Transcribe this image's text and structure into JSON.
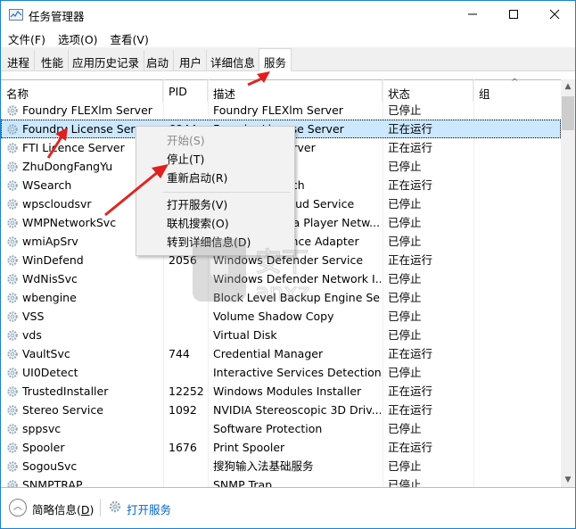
{
  "window": {
    "title": "任务管理器",
    "controls": {
      "minimize": "—",
      "maximize": "☐",
      "close": "✕"
    }
  },
  "menubar": {
    "items": [
      {
        "label": "文件(F)"
      },
      {
        "label": "选项(O)"
      },
      {
        "label": "查看(V)"
      }
    ]
  },
  "tabs": [
    {
      "label": "进程",
      "active": false
    },
    {
      "label": "性能",
      "active": false
    },
    {
      "label": "应用历史记录",
      "active": false
    },
    {
      "label": "启动",
      "active": false
    },
    {
      "label": "用户",
      "active": false
    },
    {
      "label": "详细信息",
      "active": false
    },
    {
      "label": "服务",
      "active": true
    }
  ],
  "table": {
    "columns": [
      {
        "key": "name",
        "label": "名称"
      },
      {
        "key": "pid",
        "label": "PID"
      },
      {
        "key": "desc",
        "label": "描述"
      },
      {
        "key": "status",
        "label": "状态"
      },
      {
        "key": "group",
        "label": "组"
      }
    ],
    "sort_indicator": "^",
    "rows": [
      {
        "name": "Foundry FLEXlm Server",
        "pid": "",
        "desc": "Foundry FLEXlm Server",
        "status": "已停止",
        "group": ""
      },
      {
        "name": "Foundry License Server",
        "pid": "6844",
        "desc": "Foundry License Server",
        "status": "正在运行",
        "group": "",
        "selected": true
      },
      {
        "name": "FTI Licence Server",
        "pid": "",
        "desc": "FTI Licence Server",
        "status": "正在运行",
        "group": ""
      },
      {
        "name": "ZhuDongFangYu",
        "pid": "",
        "desc": "",
        "status": "已停止",
        "group": ""
      },
      {
        "name": "WSearch",
        "pid": "",
        "desc": "Windows Search",
        "status": "正在运行",
        "group": ""
      },
      {
        "name": "wpscloudsvr",
        "pid": "",
        "desc": "WPS Office Cloud Service",
        "status": "已停止",
        "group": ""
      },
      {
        "name": "WMPNetworkSvc",
        "pid": "",
        "desc": "Windows Media Player Netw...",
        "status": "已停止",
        "group": ""
      },
      {
        "name": "wmiApSrv",
        "pid": "",
        "desc": "WMI Performance Adapter",
        "status": "已停止",
        "group": ""
      },
      {
        "name": "WinDefend",
        "pid": "2056",
        "desc": "Windows Defender Service",
        "status": "正在运行",
        "group": ""
      },
      {
        "name": "WdNisSvc",
        "pid": "",
        "desc": "Windows Defender Network I...",
        "status": "已停止",
        "group": ""
      },
      {
        "name": "wbengine",
        "pid": "",
        "desc": "Block Level Backup Engine Se...",
        "status": "已停止",
        "group": ""
      },
      {
        "name": "VSS",
        "pid": "",
        "desc": "Volume Shadow Copy",
        "status": "已停止",
        "group": ""
      },
      {
        "name": "vds",
        "pid": "",
        "desc": "Virtual Disk",
        "status": "已停止",
        "group": ""
      },
      {
        "name": "VaultSvc",
        "pid": "744",
        "desc": "Credential Manager",
        "status": "正在运行",
        "group": ""
      },
      {
        "name": "UI0Detect",
        "pid": "",
        "desc": "Interactive Services Detection",
        "status": "已停止",
        "group": ""
      },
      {
        "name": "TrustedInstaller",
        "pid": "12252",
        "desc": "Windows Modules Installer",
        "status": "正在运行",
        "group": ""
      },
      {
        "name": "Stereo Service",
        "pid": "1092",
        "desc": "NVIDIA Stereoscopic 3D Driv...",
        "status": "正在运行",
        "group": ""
      },
      {
        "name": "sppsvc",
        "pid": "",
        "desc": "Software Protection",
        "status": "已停止",
        "group": ""
      },
      {
        "name": "Spooler",
        "pid": "1676",
        "desc": "Print Spooler",
        "status": "正在运行",
        "group": ""
      },
      {
        "name": "SogouSvc",
        "pid": "",
        "desc": "搜狗输入法基础服务",
        "status": "已停止",
        "group": ""
      },
      {
        "name": "SNMPTRAP",
        "pid": "",
        "desc": "SNMP Trap",
        "status": "已停止",
        "group": ""
      }
    ]
  },
  "context_menu": {
    "items": [
      {
        "label": "开始(S)",
        "disabled": true
      },
      {
        "label": "停止(T)",
        "disabled": false
      },
      {
        "label": "重新启动(R)",
        "disabled": false
      },
      {
        "separator": true
      },
      {
        "label": "打开服务(V)",
        "disabled": false
      },
      {
        "label": "联机搜索(O)",
        "disabled": false
      },
      {
        "label": "转到详细信息(D)",
        "disabled": false
      }
    ]
  },
  "footer": {
    "fewer_details_label": "简略信息(",
    "fewer_details_accel": "D",
    "fewer_details_close": ")",
    "open_services_label": "打开服务"
  },
  "colors": {
    "selection": "#cce8ff",
    "window_border": "#1883d7",
    "link": "#0066cc",
    "annotation_arrow": "#e0201e"
  }
}
